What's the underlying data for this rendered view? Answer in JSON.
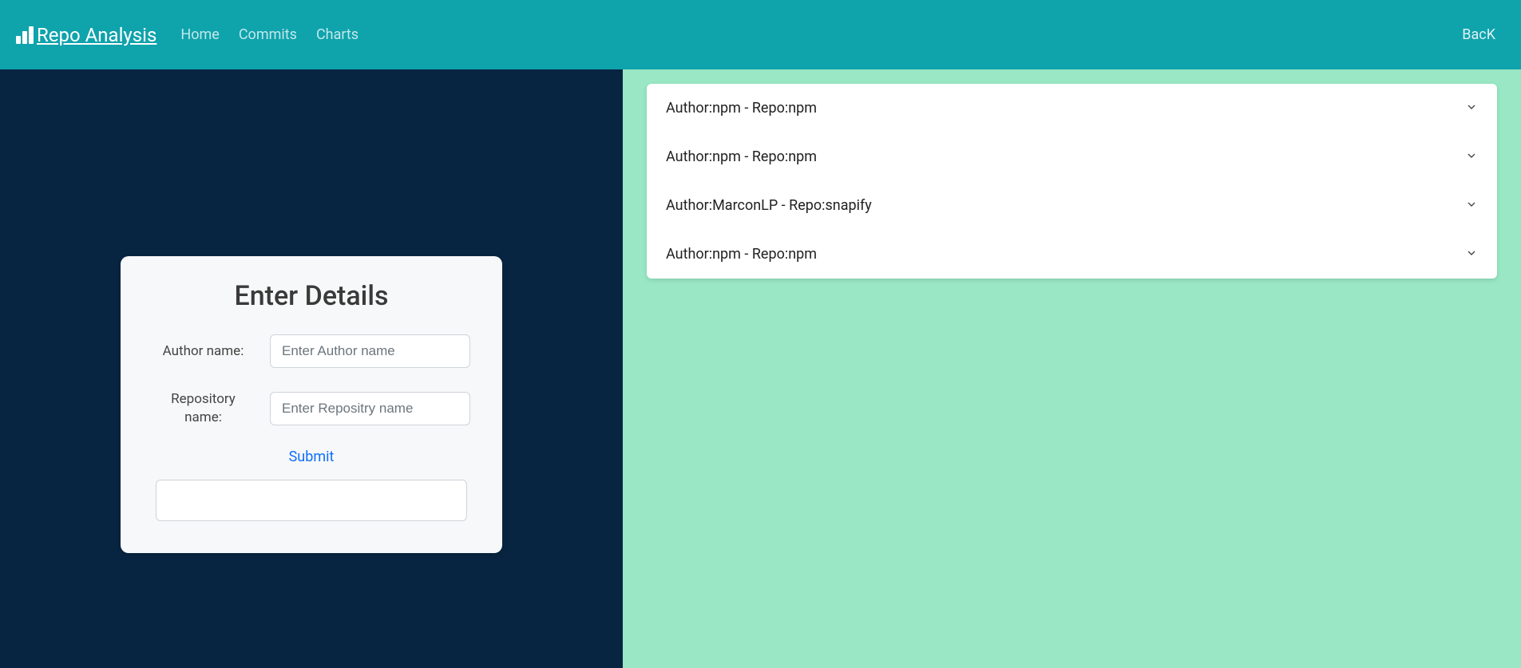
{
  "nav": {
    "brand": "Repo Analysis",
    "links": {
      "home": "Home",
      "commits": "Commits",
      "charts": "Charts"
    },
    "back": "BacK"
  },
  "form": {
    "title": "Enter Details",
    "author_label": "Author name:",
    "author_placeholder": "Enter Author name",
    "repo_label": "Repository name:",
    "repo_placeholder": "Enter Repositry name",
    "submit": "Submit"
  },
  "accordion": {
    "items": [
      {
        "label": "Author:npm - Repo:npm"
      },
      {
        "label": "Author:npm - Repo:npm"
      },
      {
        "label": "Author:MarconLP - Repo:snapify"
      },
      {
        "label": "Author:npm - Repo:npm"
      }
    ]
  }
}
